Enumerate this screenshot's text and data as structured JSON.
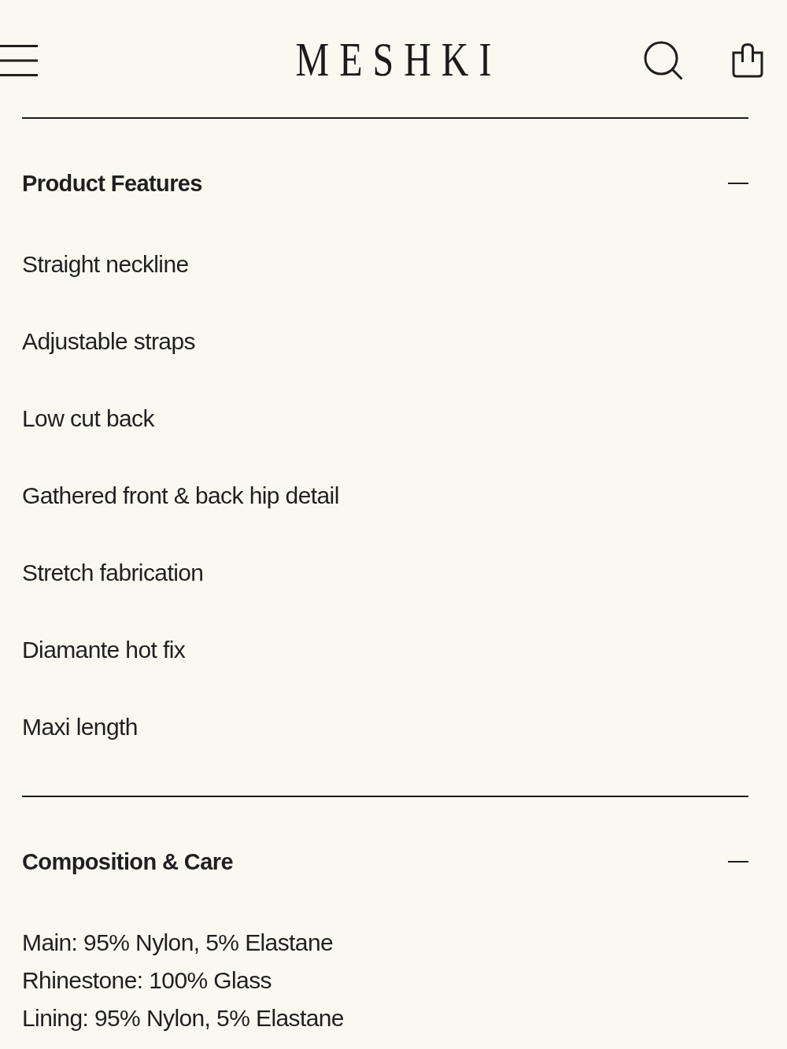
{
  "header": {
    "logo": "MESHKI"
  },
  "sections": [
    {
      "title": "Product Features",
      "expanded": true,
      "kind": "list",
      "items": [
        "Straight neckline",
        "Adjustable straps",
        "Low cut back",
        "Gathered front & back hip detail",
        "Stretch fabrication",
        "Diamante hot fix",
        "Maxi length"
      ]
    },
    {
      "title": "Composition & Care",
      "expanded": true,
      "kind": "lines",
      "items": [
        "Main: 95% Nylon, 5% Elastane",
        "Rhinestone: 100% Glass",
        "Lining: 95% Nylon, 5% Elastane"
      ]
    }
  ]
}
